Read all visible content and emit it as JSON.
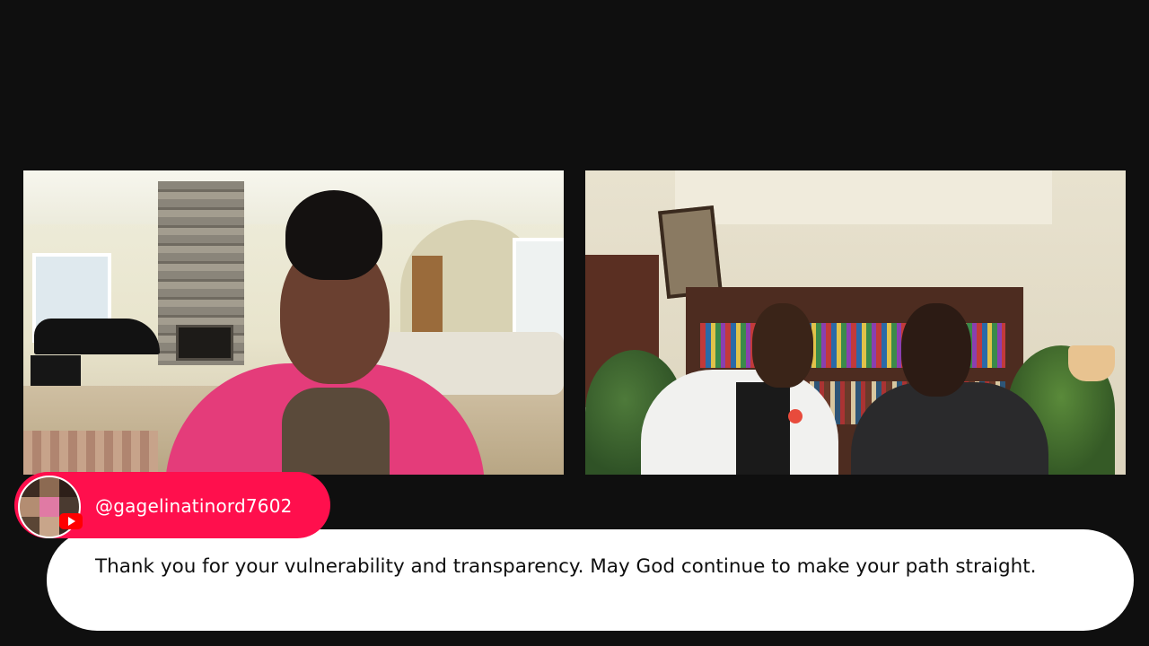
{
  "video_feeds": {
    "left_participant": "video-feed-left",
    "right_participants": "video-feed-right"
  },
  "comment": {
    "author_handle": "@gagelinatinord7602",
    "avatar_icon": "user-avatar-collage",
    "platform_icon": "youtube-icon",
    "text": "Thank you for your vulnerability and transparency. May God continue to make your path straight."
  },
  "colors": {
    "background": "#0f0f0f",
    "badge_accent": "#ff0f4d",
    "bubble": "#ffffff",
    "message_text": "#0f0f0f",
    "youtube_red": "#ff0000"
  }
}
